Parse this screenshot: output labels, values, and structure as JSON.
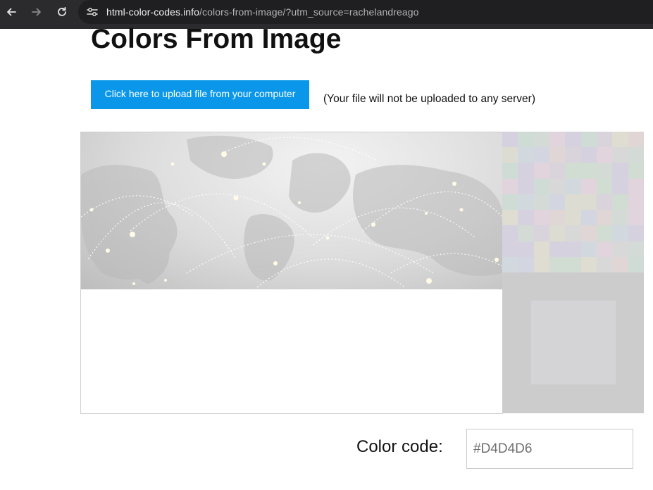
{
  "browser": {
    "url_host": "html-color-codes.info",
    "url_path": "/colors-from-image/?utm_source=rachelandreago",
    "icons": [
      "back-arrow-icon",
      "forward-arrow-icon",
      "reload-icon",
      "site-settings-icon"
    ]
  },
  "page": {
    "title": "Colors From Image",
    "upload_button": "Click here to upload file from your computer",
    "upload_note": "(Your file will not be uploaded to any server)",
    "color_code_label": "Color code:",
    "color_code_value": "#D4D4D6"
  },
  "colors": {
    "upload_button_bg": "#0a97ea",
    "preview_swatch": "#d4d4d6",
    "preview_panel_bg": "#cccccc",
    "toolbar_bg": "#2b2b2e"
  }
}
